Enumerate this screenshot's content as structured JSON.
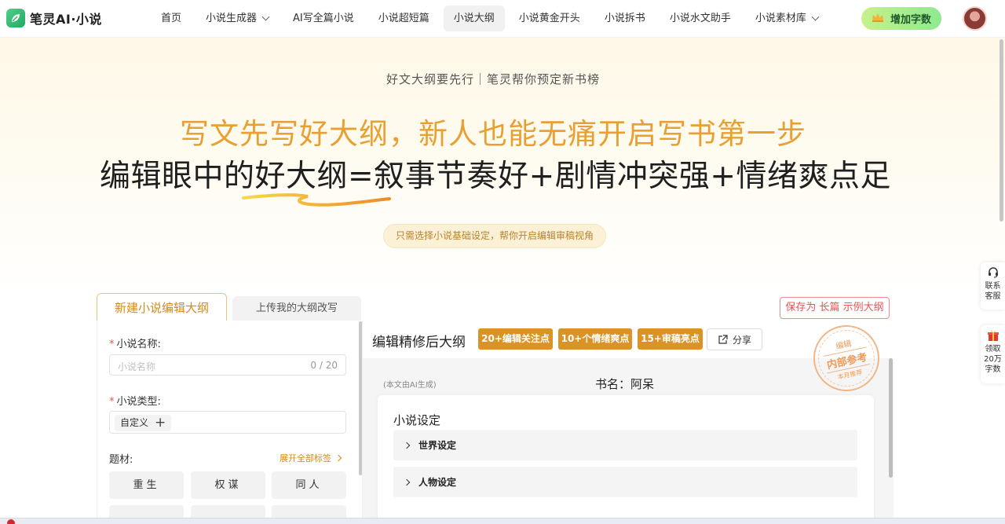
{
  "nav": {
    "logo_text": "笔灵AI·小说",
    "menu": [
      {
        "label": "首页",
        "dropdown": false,
        "active": false
      },
      {
        "label": "小说生成器",
        "dropdown": true,
        "active": false
      },
      {
        "label": "AI写全篇小说",
        "dropdown": false,
        "active": false
      },
      {
        "label": "小说超短篇",
        "dropdown": false,
        "active": false
      },
      {
        "label": "小说大纲",
        "dropdown": false,
        "active": true
      },
      {
        "label": "小说黄金开头",
        "dropdown": false,
        "active": false
      },
      {
        "label": "小说拆书",
        "dropdown": false,
        "active": false
      },
      {
        "label": "小说水文助手",
        "dropdown": false,
        "active": false
      },
      {
        "label": "小说素材库",
        "dropdown": true,
        "active": false
      }
    ],
    "add_words_label": "增加字数"
  },
  "hero": {
    "subtitle": "好文大纲要先行｜笔灵帮你预定新书榜",
    "headline_1": "写文先写好大纲，新人也能无痛开启写书第一步",
    "headline_2": "编辑眼中的好大纲=叙事节奏好+剧情冲突强+情绪爽点足",
    "pill": "只需选择小说基础设定，帮你开启编辑审稿视角"
  },
  "tabs": {
    "new_outline": "新建小说编辑大纲",
    "upload_outline": "上传我的大纲改写"
  },
  "save_button": "保存为 长篇 示例大纲",
  "form": {
    "name_label": "小说名称:",
    "name_placeholder": "小说名称",
    "name_count": "0 / 20",
    "type_label": "小说类型:",
    "type_tag": "自定义",
    "genre_label": "题材:",
    "expand_all": "展开全部标签",
    "genres": [
      "重生",
      "权谋",
      "同人"
    ]
  },
  "outline": {
    "title": "编辑精修后大纲",
    "badges": [
      "20+编辑关注点",
      "10+个情绪爽点",
      "15+审稿亮点"
    ],
    "share": "分享",
    "ai_note": "(本文由AI生成)",
    "book_name": "书名：阿呆",
    "section_title": "小说设定",
    "sections": [
      "世界设定",
      "人物设定"
    ],
    "stamp": {
      "top": "编辑",
      "middle": "内部参考",
      "bottom": "本月推荐"
    }
  },
  "side": {
    "service": "联系客服",
    "gift": "领取20万字数"
  },
  "colors": {
    "accent_orange": "#d99326",
    "headline_orange": "#e8a033",
    "green_button": "#8fe98f"
  }
}
